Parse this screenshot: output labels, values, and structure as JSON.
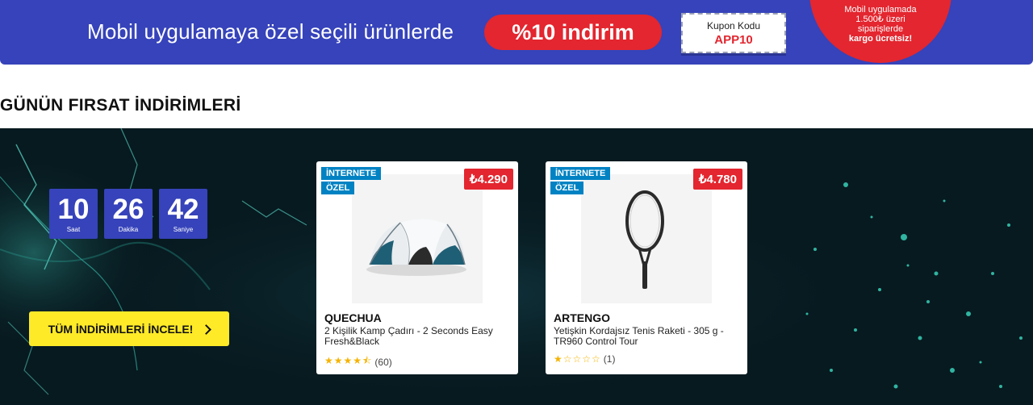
{
  "promo": {
    "text": "Mobil uygulamaya özel seçili ürünlerde",
    "discount": "%10 indirim",
    "coupon_label": "Kupon Kodu",
    "coupon_code": "APP10",
    "cargo_line1": "Mobil uygulamada",
    "cargo_line2": "1.500₺ üzeri",
    "cargo_line3": "siparişlerde",
    "cargo_line4": "kargo ücretsiz!"
  },
  "section": {
    "title": "GÜNÜN FIRSAT İNDİRİMLERİ"
  },
  "countdown": {
    "hours": "10",
    "hours_label": "Saat",
    "minutes": "26",
    "minutes_label": "Dakika",
    "seconds": "42",
    "seconds_label": "Saniye"
  },
  "cta": {
    "label": "TÜM İNDİRİMLERİ İNCELE!"
  },
  "products": [
    {
      "badge_line1": "İNTERNETE",
      "badge_line2": "ÖZEL",
      "price": "₺4.290",
      "brand": "QUECHUA",
      "name": "2 Kişilik Kamp Çadırı - 2 Seconds Easy Fresh&Black",
      "rating": 4.5,
      "stars": "★★★★⯪",
      "reviews": "(60)"
    },
    {
      "badge_line1": "İNTERNETE",
      "badge_line2": "ÖZEL",
      "price": "₺4.780",
      "brand": "ARTENGO",
      "name": "Yetişkin Kordajsız Tenis Raketi - 305 g - TR960 Control Tour",
      "rating": 1,
      "stars": "★☆☆☆☆",
      "reviews": "(1)"
    }
  ],
  "colors": {
    "brand_blue": "#3643ba",
    "discount_red": "#e3262f",
    "cta_yellow": "#ffea28",
    "badge_blue": "#0082c3",
    "deals_bg": "#071a20"
  }
}
